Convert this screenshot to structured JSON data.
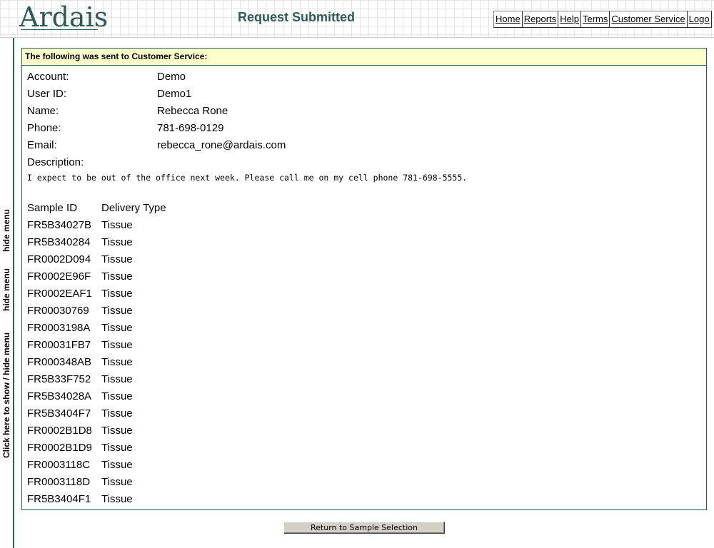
{
  "header": {
    "logo_text": "Ardais",
    "page_title": "Request Submitted",
    "nav": [
      {
        "label": "Home"
      },
      {
        "label": "Reports"
      },
      {
        "label": "Help"
      },
      {
        "label": "Terms"
      },
      {
        "label": "Customer Service"
      },
      {
        "label": "Logo"
      }
    ]
  },
  "sidebar": {
    "hide_menu_1": "hide menu",
    "hide_menu_2": "hide menu",
    "show_hide": "Click here to show / hide menu"
  },
  "panel": {
    "heading": "The following was sent to Customer Service:",
    "fields": [
      {
        "label": "Account:",
        "value": "Demo"
      },
      {
        "label": "User ID:",
        "value": "Demo1"
      },
      {
        "label": "Name:",
        "value": "Rebecca Rone"
      },
      {
        "label": "Phone:",
        "value": "781-698-0129"
      },
      {
        "label": "Email:",
        "value": "rebecca_rone@ardais.com"
      }
    ],
    "description_label": "Description:",
    "description_text": "I expect to be out of the office next week. Please call me on my cell phone 781-698-5555.",
    "samples_header": {
      "id": "Sample ID",
      "type": "Delivery Type"
    },
    "samples": [
      {
        "id": "FR5B34027B",
        "type": "Tissue"
      },
      {
        "id": "FR5B340284",
        "type": "Tissue"
      },
      {
        "id": "FR0002D094",
        "type": "Tissue"
      },
      {
        "id": "FR0002E96F",
        "type": "Tissue"
      },
      {
        "id": "FR0002EAF1",
        "type": "Tissue"
      },
      {
        "id": "FR00030769",
        "type": "Tissue"
      },
      {
        "id": "FR0003198A",
        "type": "Tissue"
      },
      {
        "id": "FR00031FB7",
        "type": "Tissue"
      },
      {
        "id": "FR000348AB",
        "type": "Tissue"
      },
      {
        "id": "FR5B33F752",
        "type": "Tissue"
      },
      {
        "id": "FR5B34028A",
        "type": "Tissue"
      },
      {
        "id": "FR5B3404F7",
        "type": "Tissue"
      },
      {
        "id": "FR0002B1D8",
        "type": "Tissue"
      },
      {
        "id": "FR0002B1D9",
        "type": "Tissue"
      },
      {
        "id": "FR0003118C",
        "type": "Tissue"
      },
      {
        "id": "FR0003118D",
        "type": "Tissue"
      },
      {
        "id": "FR5B3404F1",
        "type": "Tissue"
      }
    ]
  },
  "actions": {
    "return_label": "Return to Sample Selection"
  },
  "colors": {
    "brand": "#2f5b57",
    "panel_header_bg": "#ffffcc",
    "button_bg": "#d4d0c8"
  }
}
